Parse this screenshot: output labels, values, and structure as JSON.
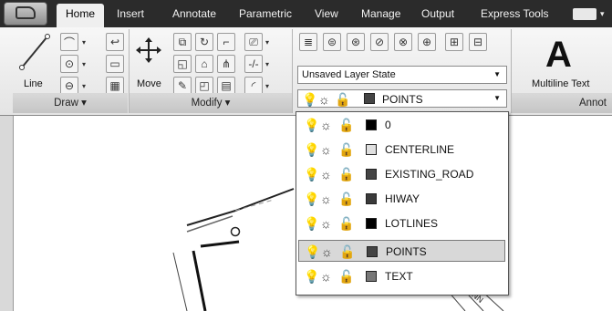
{
  "tabs": [
    {
      "label": "Home",
      "active": true
    },
    {
      "label": "Insert"
    },
    {
      "label": "Annotate"
    },
    {
      "label": "Parametric"
    },
    {
      "label": "View"
    },
    {
      "label": "Manage"
    },
    {
      "label": "Output"
    },
    {
      "label": "Express Tools"
    }
  ],
  "ribbon": {
    "line_label": "Line",
    "move_label": "Move",
    "draw_panel": "Draw ▾",
    "modify_panel": "Modify ▾",
    "layer_state": "Unsaved Layer State",
    "current_layer": "POINTS",
    "multiline_text": "Multiline Text",
    "annot_panel": "Annot",
    "text_glyph": "A"
  },
  "layers": [
    {
      "name": "0",
      "color": "#000000"
    },
    {
      "name": "CENTERLINE",
      "color": "#e0e0e0"
    },
    {
      "name": "EXISTING_ROAD",
      "color": "#444444"
    },
    {
      "name": "HIWAY",
      "color": "#3a3a3a"
    },
    {
      "name": "LOTLINES",
      "color": "#000000"
    },
    {
      "name": "POINTS",
      "color": "#444444",
      "selected": true
    },
    {
      "name": "TEXT",
      "color": "#777777"
    }
  ],
  "canvas": {
    "road_label": "RONN"
  }
}
